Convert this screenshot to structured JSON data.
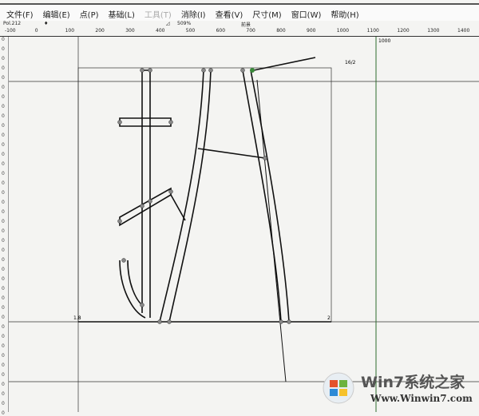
{
  "menu": [
    "文件(F)",
    "编辑(E)",
    "点(P)",
    "基础(L)",
    "工具(T)",
    "消除(I)",
    "查看(V)",
    "尺寸(M)",
    "窗口(W)",
    "帮助(H)"
  ],
  "toolbar": {
    "coord": "Pol.212",
    "zoom": "509%",
    "fg": "前景"
  },
  "ruler": [
    "-100",
    "0",
    "100",
    "200",
    "300",
    "400",
    "500",
    "600",
    "700",
    "800",
    "900",
    "1000",
    "1100",
    "1200",
    "1300",
    "1400"
  ],
  "canvas": {
    "label_1000": "1000",
    "label_half": "16/2",
    "label_corner": "1.8",
    "label_2": "2"
  },
  "watermark": {
    "brand": "Win7系统之家",
    "url": "Www.Winwin7.com"
  },
  "colors": {
    "guide": "#2e6b2e",
    "line": "#111"
  }
}
